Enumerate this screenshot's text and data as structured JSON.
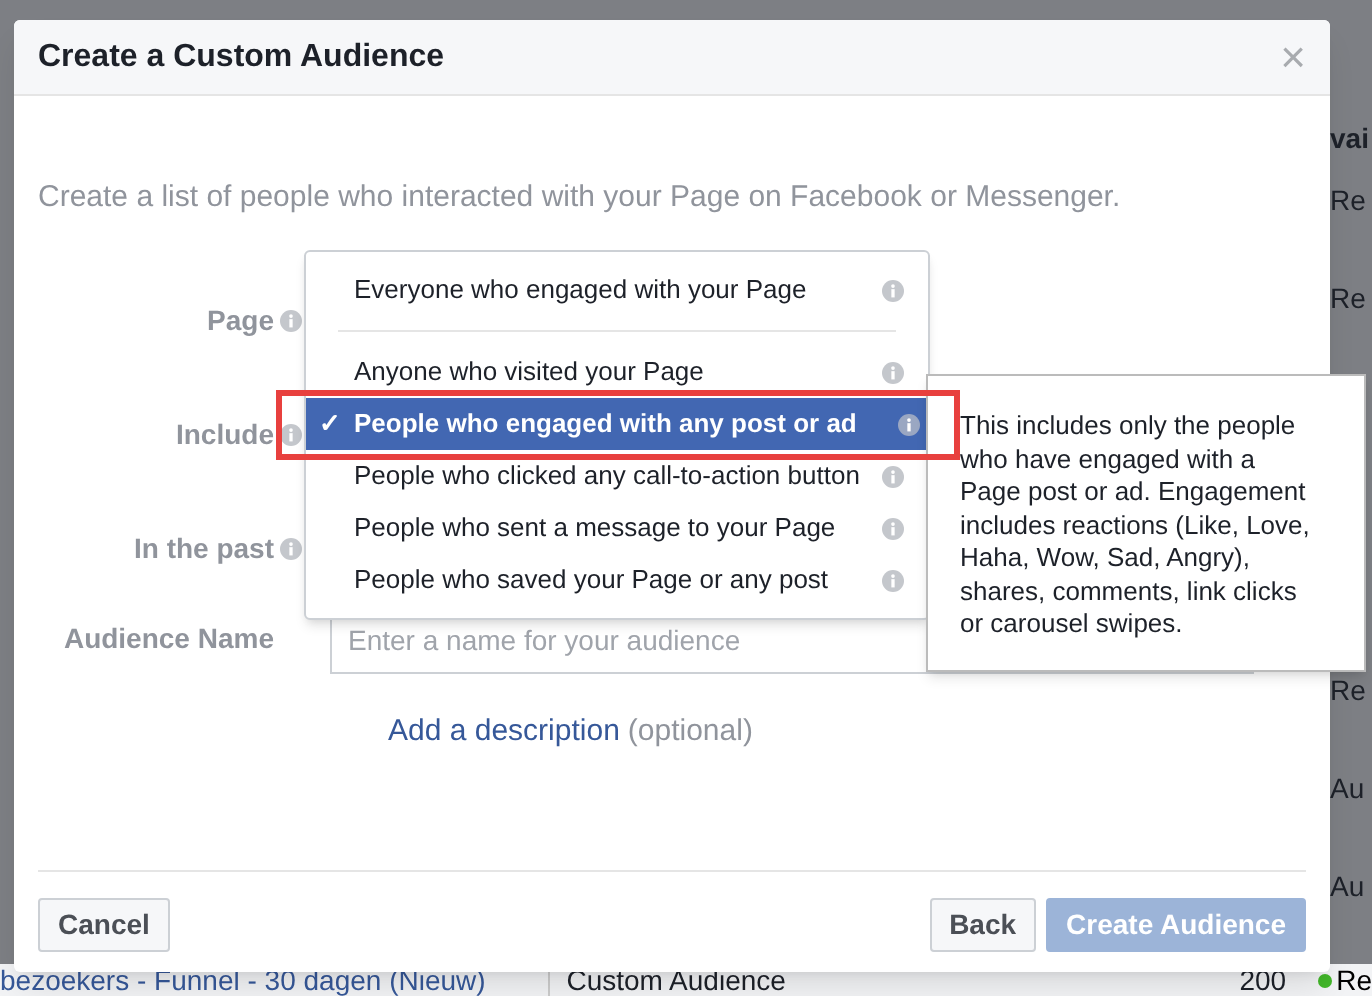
{
  "background": {
    "right_column": [
      {
        "text": "vai",
        "kind": "header"
      },
      {
        "text": "Re",
        "kind": "cell"
      },
      {
        "text": "Re",
        "kind": "cell"
      },
      {
        "kind": "gap"
      },
      {
        "kind": "gap"
      },
      {
        "kind": "gap"
      },
      {
        "text": "Re",
        "kind": "cell"
      },
      {
        "text": "Au",
        "kind": "cell"
      },
      {
        "text": "Au",
        "kind": "cell"
      }
    ],
    "bottom_row": {
      "name": "bezoekers - Funnel - 30 dagen (Nieuw)",
      "type": "Custom Audience",
      "size": "200",
      "status": "Re"
    }
  },
  "dialog": {
    "title": "Create a Custom Audience",
    "close": "×",
    "intro": "Create a list of people who interacted with your Page on Facebook or Messenger.",
    "fields": [
      {
        "label": "Page"
      },
      {
        "label": "Include"
      },
      {
        "label": "In the past"
      }
    ],
    "audience_name": {
      "label": "Audience Name",
      "placeholder": "Enter a name for your audience"
    },
    "description_link": "Add a description",
    "description_note": "(optional)",
    "buttons": [
      {
        "label": "Cancel",
        "kind": "secondary",
        "disabled": false
      },
      {
        "label": "Back",
        "kind": "secondary",
        "disabled": false
      },
      {
        "label": "Create Audience",
        "kind": "primary",
        "disabled": true
      }
    ]
  },
  "dropdown": {
    "items": [
      {
        "label": "Everyone who engaged with your Page",
        "selected": false,
        "separator_after": true
      },
      {
        "label": "Anyone who visited your Page",
        "selected": false,
        "separator_after": false
      },
      {
        "label": "People who engaged with any post or ad",
        "selected": true,
        "separator_after": false
      },
      {
        "label": "People who clicked any call-to-action button",
        "selected": false,
        "separator_after": false
      },
      {
        "label": "People who sent a message to your Page",
        "selected": false,
        "separator_after": false
      },
      {
        "label": "People who saved your Page or any post",
        "selected": false,
        "separator_after": false
      }
    ],
    "check": "✓"
  },
  "tooltip": "This includes only the people who have engaged with a Page post or ad. Engagement includes reactions (Like, Love, Haha, Wow, Sad, Angry), shares, comments, link clicks or carousel swipes."
}
